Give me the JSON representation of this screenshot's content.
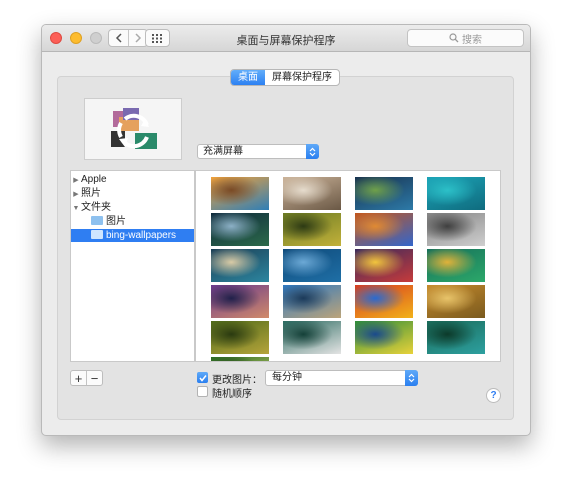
{
  "window": {
    "title": "桌面与屏幕保护程序"
  },
  "search": {
    "placeholder": "搜索",
    "icon": "search-icon"
  },
  "tabs": [
    {
      "label": "桌面",
      "active": true
    },
    {
      "label": "屏幕保护程序",
      "active": false
    }
  ],
  "fill_mode": {
    "value": "充满屏幕"
  },
  "sidebar": {
    "items": [
      {
        "label": "Apple",
        "expanded": false
      },
      {
        "label": "照片",
        "expanded": false
      },
      {
        "label": "文件夹",
        "expanded": true
      },
      {
        "label": "图片",
        "child": true
      },
      {
        "label": "bing-wallpapers",
        "child": true,
        "selected": true
      }
    ]
  },
  "thumbnails": [
    {
      "name": "arch-rock-sunset",
      "colors": [
        "#f1a13a",
        "#2f7fb7",
        "#7a4a25"
      ]
    },
    {
      "name": "goat-horns",
      "colors": [
        "#ccb49a",
        "#6a5845",
        "#e6dccd"
      ]
    },
    {
      "name": "earth-from-space",
      "colors": [
        "#18324f",
        "#2d7aa8",
        "#6fa04a"
      ]
    },
    {
      "name": "turquoise-lake",
      "colors": [
        "#1ca4b7",
        "#0f6b7e",
        "#2cc0c8"
      ]
    },
    {
      "name": "night-milky-way",
      "colors": [
        "#0f2a3c",
        "#2c6a4a",
        "#8cb0c6"
      ]
    },
    {
      "name": "green-insect",
      "colors": [
        "#6a7a24",
        "#c2b13a",
        "#2d3a14"
      ]
    },
    {
      "name": "blue-archway",
      "colors": [
        "#c2561d",
        "#3366cc",
        "#e08a33"
      ]
    },
    {
      "name": "grey-waterfall",
      "colors": [
        "#848484",
        "#cfcfcf",
        "#3f3f3f"
      ]
    },
    {
      "name": "harbor-town",
      "colors": [
        "#1c3f55",
        "#2c86a0",
        "#d9cba6"
      ]
    },
    {
      "name": "blue-fish-school",
      "colors": [
        "#0f4a7a",
        "#1f6fa6",
        "#6ca9d6"
      ]
    },
    {
      "name": "coral-reef",
      "colors": [
        "#3b2a5c",
        "#c73b3b",
        "#f2c53d"
      ]
    },
    {
      "name": "green-lizard",
      "colors": [
        "#16705a",
        "#2ca86a",
        "#e0b23a"
      ]
    },
    {
      "name": "purple-sky-city",
      "colors": [
        "#6a3a8c",
        "#d18a6a",
        "#20204a"
      ]
    },
    {
      "name": "coastal-cliffs",
      "colors": [
        "#2e78c0",
        "#bca47a",
        "#1b3a5a"
      ]
    },
    {
      "name": "colorful-festival",
      "colors": [
        "#d63c20",
        "#f2b21a",
        "#2a6ad0"
      ]
    },
    {
      "name": "golden-hay-bale",
      "colors": [
        "#c58a2c",
        "#7a5a1e",
        "#e8c46a"
      ]
    },
    {
      "name": "mossy-forest",
      "colors": [
        "#4f6a1a",
        "#b5a43a",
        "#2a3a10"
      ]
    },
    {
      "name": "aerial-road",
      "colors": [
        "#2a6a60",
        "#e4e4e4",
        "#144038"
      ]
    },
    {
      "name": "festival-crowd",
      "colors": [
        "#2e8c3a",
        "#e8d23a",
        "#1a4a8c"
      ]
    },
    {
      "name": "peacock-birds",
      "colors": [
        "#1a6a58",
        "#2da0a0",
        "#0c3a2a"
      ]
    },
    {
      "name": "sunlit-forest",
      "colors": [
        "#2a6a24",
        "#d8d870",
        "#173a14"
      ]
    }
  ],
  "change_picture": {
    "label": "更改图片：",
    "checked": true,
    "interval": "每分钟"
  },
  "random_order": {
    "label": "随机顺序",
    "checked": false
  },
  "add_label": "+",
  "remove_label": "−",
  "help_label": "?"
}
